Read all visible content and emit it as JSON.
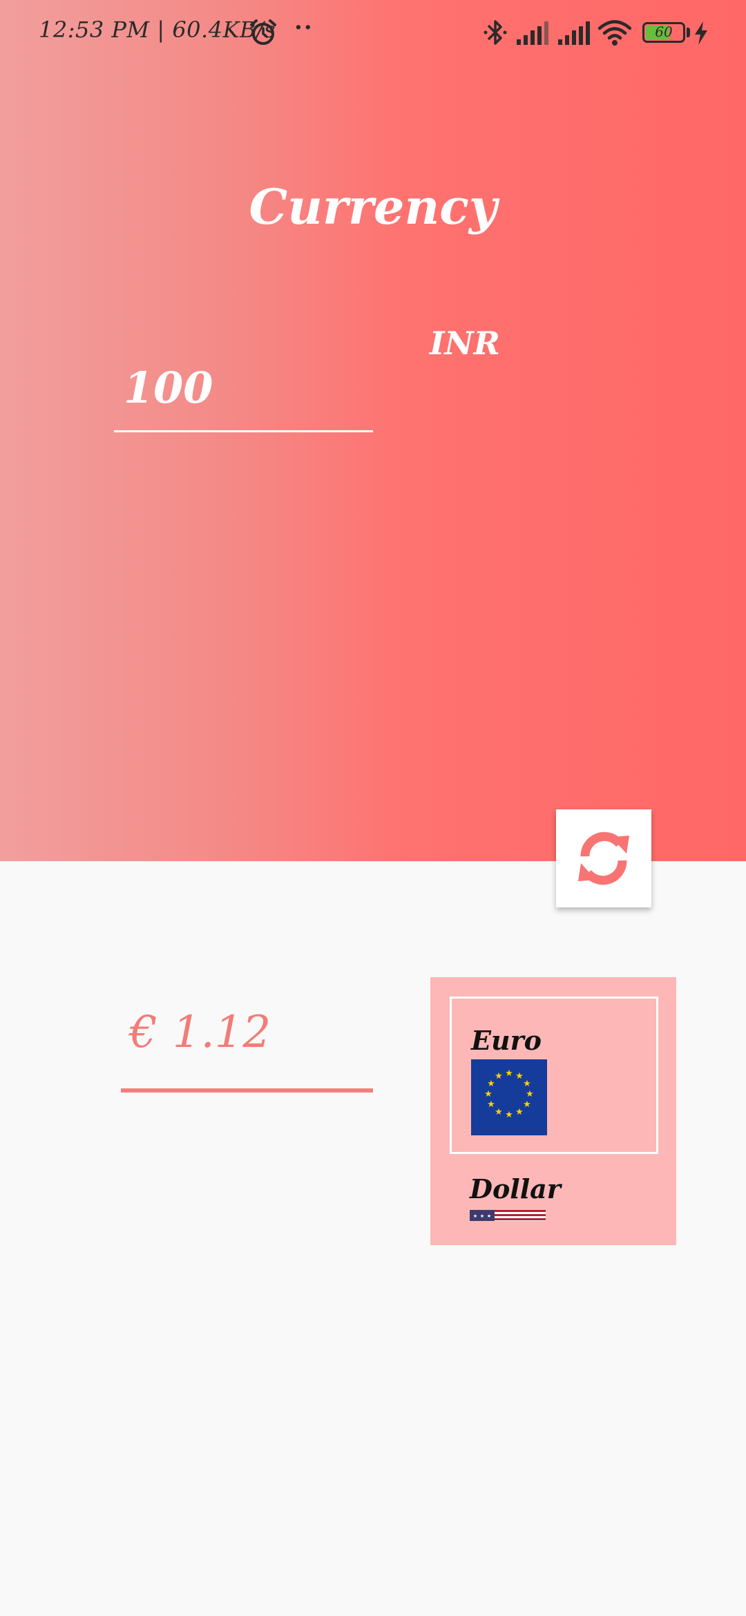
{
  "status_bar": {
    "time": "12:53 PM | 60.4KB/s",
    "dots": "··",
    "battery": "60",
    "icons": [
      "alarm-icon",
      "bluetooth-icon",
      "signal-icon",
      "signal-icon",
      "wifi-icon",
      "battery-icon",
      "charging-icon"
    ]
  },
  "header": {
    "title": "Currency"
  },
  "converter": {
    "amount_value": "100",
    "from_currency": "INR",
    "swap_icon": "swap-refresh-icon",
    "result_symbol": "€",
    "result_value": "1.12"
  },
  "currency_list": {
    "items": [
      {
        "label": "Euro",
        "flag": "eu-flag",
        "selected": true
      },
      {
        "label": "Dollar",
        "flag": "us-flag",
        "selected": false
      }
    ]
  },
  "colors": {
    "accent": "#ff6866",
    "gradient_start": "#f19f9d",
    "list_background": "#fcb7b6",
    "result_text": "#f27c78"
  }
}
